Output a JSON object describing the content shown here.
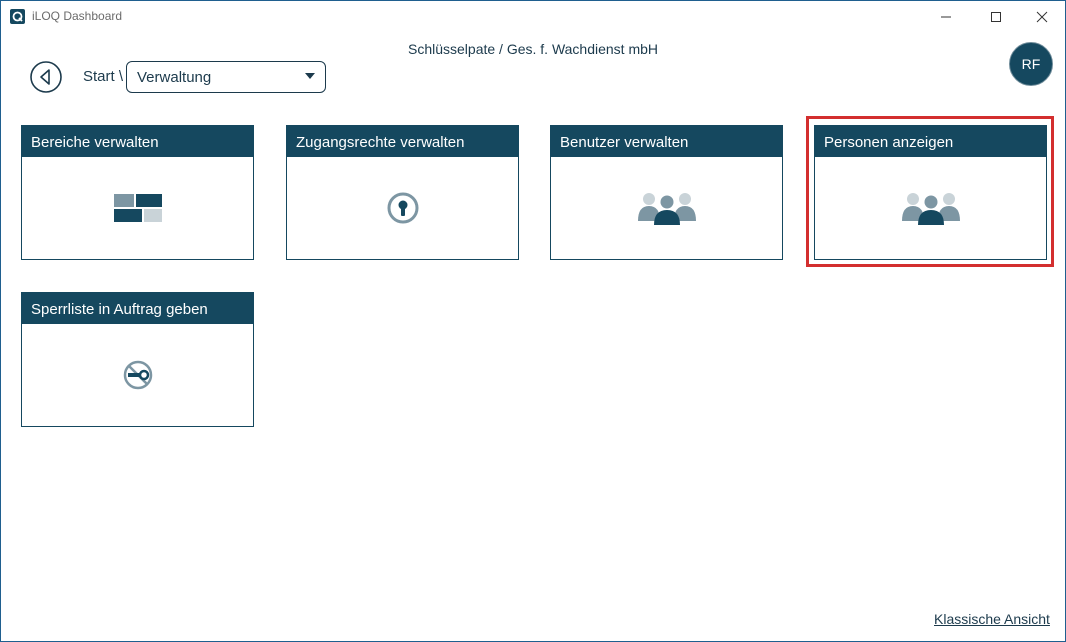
{
  "window": {
    "title": "iLOQ Dashboard",
    "controls": [
      "minimize-icon",
      "maximize-icon",
      "close-icon"
    ]
  },
  "header": {
    "organization": "Schlüsselpate / Ges. f. Wachdienst mbH",
    "user_initials": "RF"
  },
  "breadcrumb": {
    "start": "Start \\",
    "selected": "Verwaltung"
  },
  "tiles": [
    {
      "label": "Bereiche verwalten",
      "icon": "areas-grid-icon"
    },
    {
      "label": "Zugangsrechte verwalten",
      "icon": "keyhole-icon"
    },
    {
      "label": "Benutzer verwalten",
      "icon": "user-group-icon"
    },
    {
      "label": "Personen anzeigen",
      "icon": "people-group-icon"
    },
    {
      "label": "Sperrliste in Auftrag geben",
      "icon": "no-key-icon"
    }
  ],
  "footer": {
    "classic_view": "Klassische Ansicht"
  },
  "colors": {
    "primary": "#15485f",
    "highlight": "#d32f2f",
    "icon_gray": "#7d96a3"
  }
}
